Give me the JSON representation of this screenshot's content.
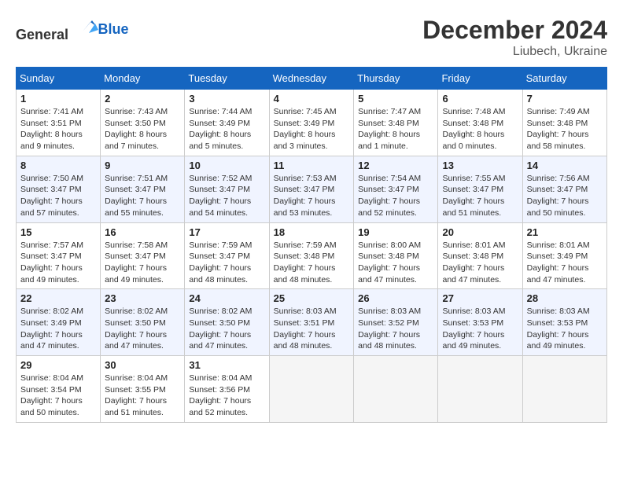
{
  "logo": {
    "text_general": "General",
    "text_blue": "Blue"
  },
  "title": {
    "month_year": "December 2024",
    "location": "Liubech, Ukraine"
  },
  "weekdays": [
    "Sunday",
    "Monday",
    "Tuesday",
    "Wednesday",
    "Thursday",
    "Friday",
    "Saturday"
  ],
  "weeks": [
    [
      {
        "day": "1",
        "sunrise": "Sunrise: 7:41 AM",
        "sunset": "Sunset: 3:51 PM",
        "daylight": "Daylight: 8 hours and 9 minutes."
      },
      {
        "day": "2",
        "sunrise": "Sunrise: 7:43 AM",
        "sunset": "Sunset: 3:50 PM",
        "daylight": "Daylight: 8 hours and 7 minutes."
      },
      {
        "day": "3",
        "sunrise": "Sunrise: 7:44 AM",
        "sunset": "Sunset: 3:49 PM",
        "daylight": "Daylight: 8 hours and 5 minutes."
      },
      {
        "day": "4",
        "sunrise": "Sunrise: 7:45 AM",
        "sunset": "Sunset: 3:49 PM",
        "daylight": "Daylight: 8 hours and 3 minutes."
      },
      {
        "day": "5",
        "sunrise": "Sunrise: 7:47 AM",
        "sunset": "Sunset: 3:48 PM",
        "daylight": "Daylight: 8 hours and 1 minute."
      },
      {
        "day": "6",
        "sunrise": "Sunrise: 7:48 AM",
        "sunset": "Sunset: 3:48 PM",
        "daylight": "Daylight: 8 hours and 0 minutes."
      },
      {
        "day": "7",
        "sunrise": "Sunrise: 7:49 AM",
        "sunset": "Sunset: 3:48 PM",
        "daylight": "Daylight: 7 hours and 58 minutes."
      }
    ],
    [
      {
        "day": "8",
        "sunrise": "Sunrise: 7:50 AM",
        "sunset": "Sunset: 3:47 PM",
        "daylight": "Daylight: 7 hours and 57 minutes."
      },
      {
        "day": "9",
        "sunrise": "Sunrise: 7:51 AM",
        "sunset": "Sunset: 3:47 PM",
        "daylight": "Daylight: 7 hours and 55 minutes."
      },
      {
        "day": "10",
        "sunrise": "Sunrise: 7:52 AM",
        "sunset": "Sunset: 3:47 PM",
        "daylight": "Daylight: 7 hours and 54 minutes."
      },
      {
        "day": "11",
        "sunrise": "Sunrise: 7:53 AM",
        "sunset": "Sunset: 3:47 PM",
        "daylight": "Daylight: 7 hours and 53 minutes."
      },
      {
        "day": "12",
        "sunrise": "Sunrise: 7:54 AM",
        "sunset": "Sunset: 3:47 PM",
        "daylight": "Daylight: 7 hours and 52 minutes."
      },
      {
        "day": "13",
        "sunrise": "Sunrise: 7:55 AM",
        "sunset": "Sunset: 3:47 PM",
        "daylight": "Daylight: 7 hours and 51 minutes."
      },
      {
        "day": "14",
        "sunrise": "Sunrise: 7:56 AM",
        "sunset": "Sunset: 3:47 PM",
        "daylight": "Daylight: 7 hours and 50 minutes."
      }
    ],
    [
      {
        "day": "15",
        "sunrise": "Sunrise: 7:57 AM",
        "sunset": "Sunset: 3:47 PM",
        "daylight": "Daylight: 7 hours and 49 minutes."
      },
      {
        "day": "16",
        "sunrise": "Sunrise: 7:58 AM",
        "sunset": "Sunset: 3:47 PM",
        "daylight": "Daylight: 7 hours and 49 minutes."
      },
      {
        "day": "17",
        "sunrise": "Sunrise: 7:59 AM",
        "sunset": "Sunset: 3:47 PM",
        "daylight": "Daylight: 7 hours and 48 minutes."
      },
      {
        "day": "18",
        "sunrise": "Sunrise: 7:59 AM",
        "sunset": "Sunset: 3:48 PM",
        "daylight": "Daylight: 7 hours and 48 minutes."
      },
      {
        "day": "19",
        "sunrise": "Sunrise: 8:00 AM",
        "sunset": "Sunset: 3:48 PM",
        "daylight": "Daylight: 7 hours and 47 minutes."
      },
      {
        "day": "20",
        "sunrise": "Sunrise: 8:01 AM",
        "sunset": "Sunset: 3:48 PM",
        "daylight": "Daylight: 7 hours and 47 minutes."
      },
      {
        "day": "21",
        "sunrise": "Sunrise: 8:01 AM",
        "sunset": "Sunset: 3:49 PM",
        "daylight": "Daylight: 7 hours and 47 minutes."
      }
    ],
    [
      {
        "day": "22",
        "sunrise": "Sunrise: 8:02 AM",
        "sunset": "Sunset: 3:49 PM",
        "daylight": "Daylight: 7 hours and 47 minutes."
      },
      {
        "day": "23",
        "sunrise": "Sunrise: 8:02 AM",
        "sunset": "Sunset: 3:50 PM",
        "daylight": "Daylight: 7 hours and 47 minutes."
      },
      {
        "day": "24",
        "sunrise": "Sunrise: 8:02 AM",
        "sunset": "Sunset: 3:50 PM",
        "daylight": "Daylight: 7 hours and 47 minutes."
      },
      {
        "day": "25",
        "sunrise": "Sunrise: 8:03 AM",
        "sunset": "Sunset: 3:51 PM",
        "daylight": "Daylight: 7 hours and 48 minutes."
      },
      {
        "day": "26",
        "sunrise": "Sunrise: 8:03 AM",
        "sunset": "Sunset: 3:52 PM",
        "daylight": "Daylight: 7 hours and 48 minutes."
      },
      {
        "day": "27",
        "sunrise": "Sunrise: 8:03 AM",
        "sunset": "Sunset: 3:53 PM",
        "daylight": "Daylight: 7 hours and 49 minutes."
      },
      {
        "day": "28",
        "sunrise": "Sunrise: 8:03 AM",
        "sunset": "Sunset: 3:53 PM",
        "daylight": "Daylight: 7 hours and 49 minutes."
      }
    ],
    [
      {
        "day": "29",
        "sunrise": "Sunrise: 8:04 AM",
        "sunset": "Sunset: 3:54 PM",
        "daylight": "Daylight: 7 hours and 50 minutes."
      },
      {
        "day": "30",
        "sunrise": "Sunrise: 8:04 AM",
        "sunset": "Sunset: 3:55 PM",
        "daylight": "Daylight: 7 hours and 51 minutes."
      },
      {
        "day": "31",
        "sunrise": "Sunrise: 8:04 AM",
        "sunset": "Sunset: 3:56 PM",
        "daylight": "Daylight: 7 hours and 52 minutes."
      },
      null,
      null,
      null,
      null
    ]
  ]
}
